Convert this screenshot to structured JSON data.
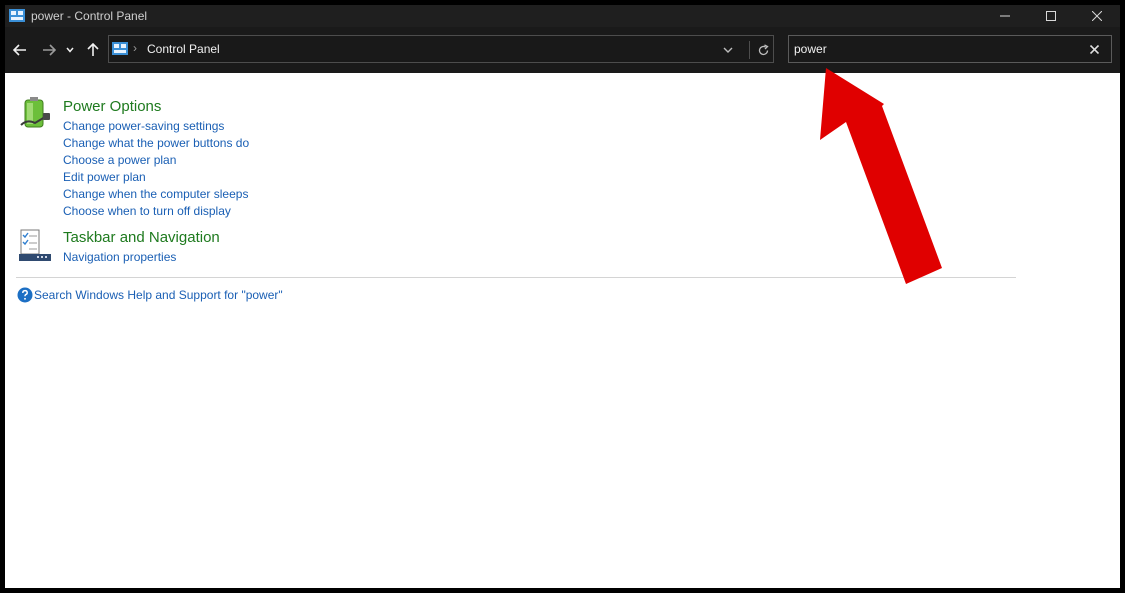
{
  "window": {
    "title": "power - Control Panel"
  },
  "address_bar": {
    "path_label": "Control Panel"
  },
  "search": {
    "value": "power"
  },
  "results": [
    {
      "title": "Power Options",
      "links": [
        "Change power-saving settings",
        "Change what the power buttons do",
        "Choose a power plan",
        "Edit power plan",
        "Change when the computer sleeps",
        "Choose when to turn off display"
      ]
    },
    {
      "title": "Taskbar and Navigation",
      "links": [
        "Navigation properties"
      ]
    }
  ],
  "help": {
    "label": "Search Windows Help and Support for \"power\""
  },
  "colors": {
    "titlebar_bg": "#1f1f1f",
    "group_title": "#1e7a1e",
    "link": "#1a5fb4",
    "annotation_arrow": "#e00000"
  },
  "icons": {
    "window": "control-panel-icon",
    "back": "arrow-left-icon",
    "forward": "arrow-right-icon",
    "recent": "chevron-down-icon",
    "up": "arrow-up-icon",
    "refresh": "refresh-icon",
    "clear": "close-icon",
    "power_options": "battery-plug-icon",
    "taskbar": "taskbar-checklist-icon",
    "help": "question-mark-icon"
  }
}
